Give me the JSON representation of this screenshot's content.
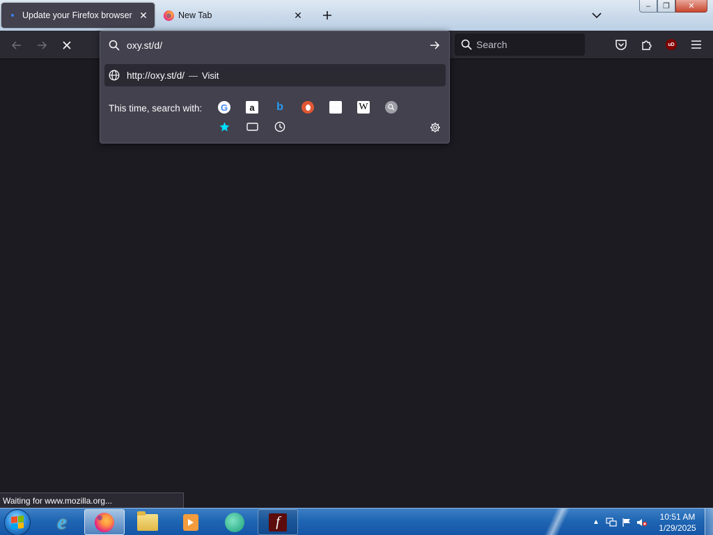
{
  "tabs": [
    {
      "title": "Update your Firefox browser",
      "active": true,
      "loading": true
    },
    {
      "title": "New Tab",
      "active": false
    }
  ],
  "window_controls": {
    "minimize": "–",
    "maximize": "❐",
    "close": "✕"
  },
  "nav": {
    "url_value": "oxy.st/d/",
    "search_placeholder": "Search"
  },
  "url_dropdown": {
    "result_url": "http://oxy.st/d/",
    "result_separator": "—",
    "result_action": "Visit",
    "oneoff_label": "This time, search with:",
    "engines": [
      {
        "name": "Google",
        "glyph": "G"
      },
      {
        "name": "Amazon",
        "glyph": "a"
      },
      {
        "name": "Bing",
        "glyph": "b"
      },
      {
        "name": "DuckDuckGo",
        "glyph": ""
      },
      {
        "name": "eBay",
        "glyph": "ebay"
      },
      {
        "name": "Wikipedia",
        "glyph": "W"
      },
      {
        "name": "Other engine",
        "glyph": ""
      }
    ],
    "modes": [
      "bookmarks",
      "tabs",
      "history"
    ]
  },
  "status_text": "Waiting for www.mozilla.org...",
  "taskbar": {
    "apps": [
      "Internet Explorer",
      "Firefox",
      "Windows Explorer",
      "Media Player",
      "Messenger",
      "Flash Player"
    ]
  },
  "clock": {
    "time": "10:51 AM",
    "date": "1/29/2025"
  },
  "colors": {
    "toolbar_bg": "#2b2a33",
    "content_bg": "#1c1b22",
    "popup_bg": "#42414d",
    "taskbar_blue": "#1f66b4"
  }
}
